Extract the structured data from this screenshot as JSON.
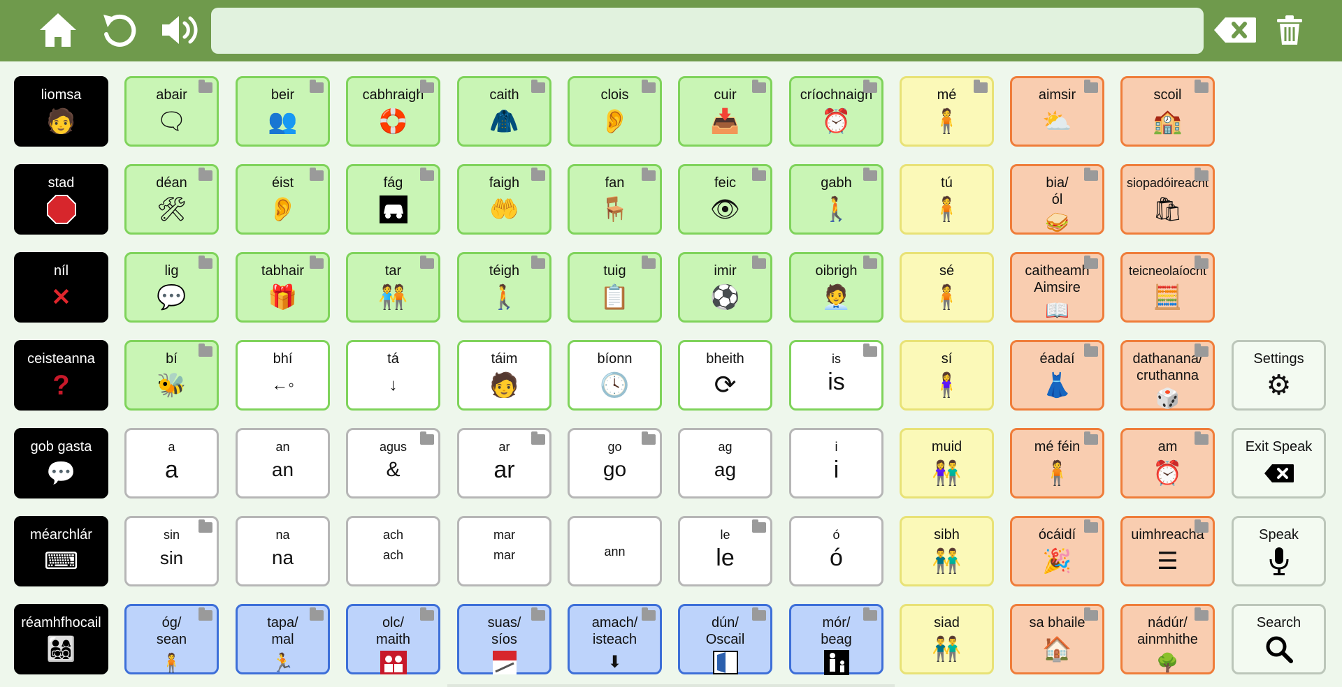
{
  "toolbar": {
    "home_icon": "home-icon",
    "undo_icon": "undo-icon",
    "speaker_icon": "speaker-icon",
    "message": "",
    "backspace_icon": "backspace-icon",
    "trash_icon": "trash-icon"
  },
  "colors": {
    "topbar": "#6f9a4c",
    "verbs": "#c9f5b5",
    "pronouns": "#fbf9b8",
    "topics": "#f9cdb0",
    "adjectives": "#bdd3fb",
    "social": "#000000"
  },
  "grid": {
    "col1": [
      "liomsa",
      "stad",
      "níl",
      "ceisteanna",
      "gob gasta",
      "méarchlár",
      "réamhfhocail"
    ],
    "row1": [
      "abair",
      "beir",
      "cabhraigh",
      "caith",
      "clois",
      "cuir",
      "críochnaigh",
      "mé",
      "aimsir",
      "scoil"
    ],
    "row2": [
      "déan",
      "éist",
      "fág",
      "faigh",
      "fan",
      "feic",
      "gabh",
      "tú",
      "bia/\nól",
      "siopadóireacht"
    ],
    "row3": [
      "lig",
      "tabhair",
      "tar",
      "téigh",
      "tuig",
      "imir",
      "oibrigh",
      "sé",
      "caitheamh\nAimsire",
      "teicneolaíocht"
    ],
    "row4": [
      "bí",
      "bhí",
      "tá",
      "táim",
      "bíonn",
      "bheith",
      "is",
      "sí",
      "éadaí",
      "dathanana/\ncruthanna"
    ],
    "row4_sub": {
      "is": "is"
    },
    "row5": [
      "a",
      "an",
      "agus",
      "ar",
      "go",
      "ag",
      "i",
      "muid",
      "mé féin",
      "am"
    ],
    "row5_sub": {
      "a": "a",
      "an": "an",
      "agus": "&",
      "ar": "ar",
      "go": "go",
      "ag": "ag",
      "i": "i"
    },
    "row6": [
      "sin",
      "na",
      "ach",
      "mar",
      "ann",
      "le",
      "ó",
      "sibh",
      "ócáidí",
      "uimhreacha"
    ],
    "row6_sub": {
      "sin": "sin",
      "na": "na",
      "ach": "ach",
      "mar": "mar",
      "le": "le",
      "ó": "ó"
    },
    "row7": [
      "óg/\nsean",
      "tapa/\nmal",
      "olc/\nmaith",
      "suas/\nsíos",
      "amach/\nisteach",
      "dún/\nOscail",
      "mór/\nbeag",
      "siad",
      "sa bhaile",
      "nádúr/\nainmhithe"
    ]
  },
  "side": {
    "settings": "Settings",
    "exit_speak": "Exit Speak",
    "speak": "Speak",
    "search": "Search"
  }
}
